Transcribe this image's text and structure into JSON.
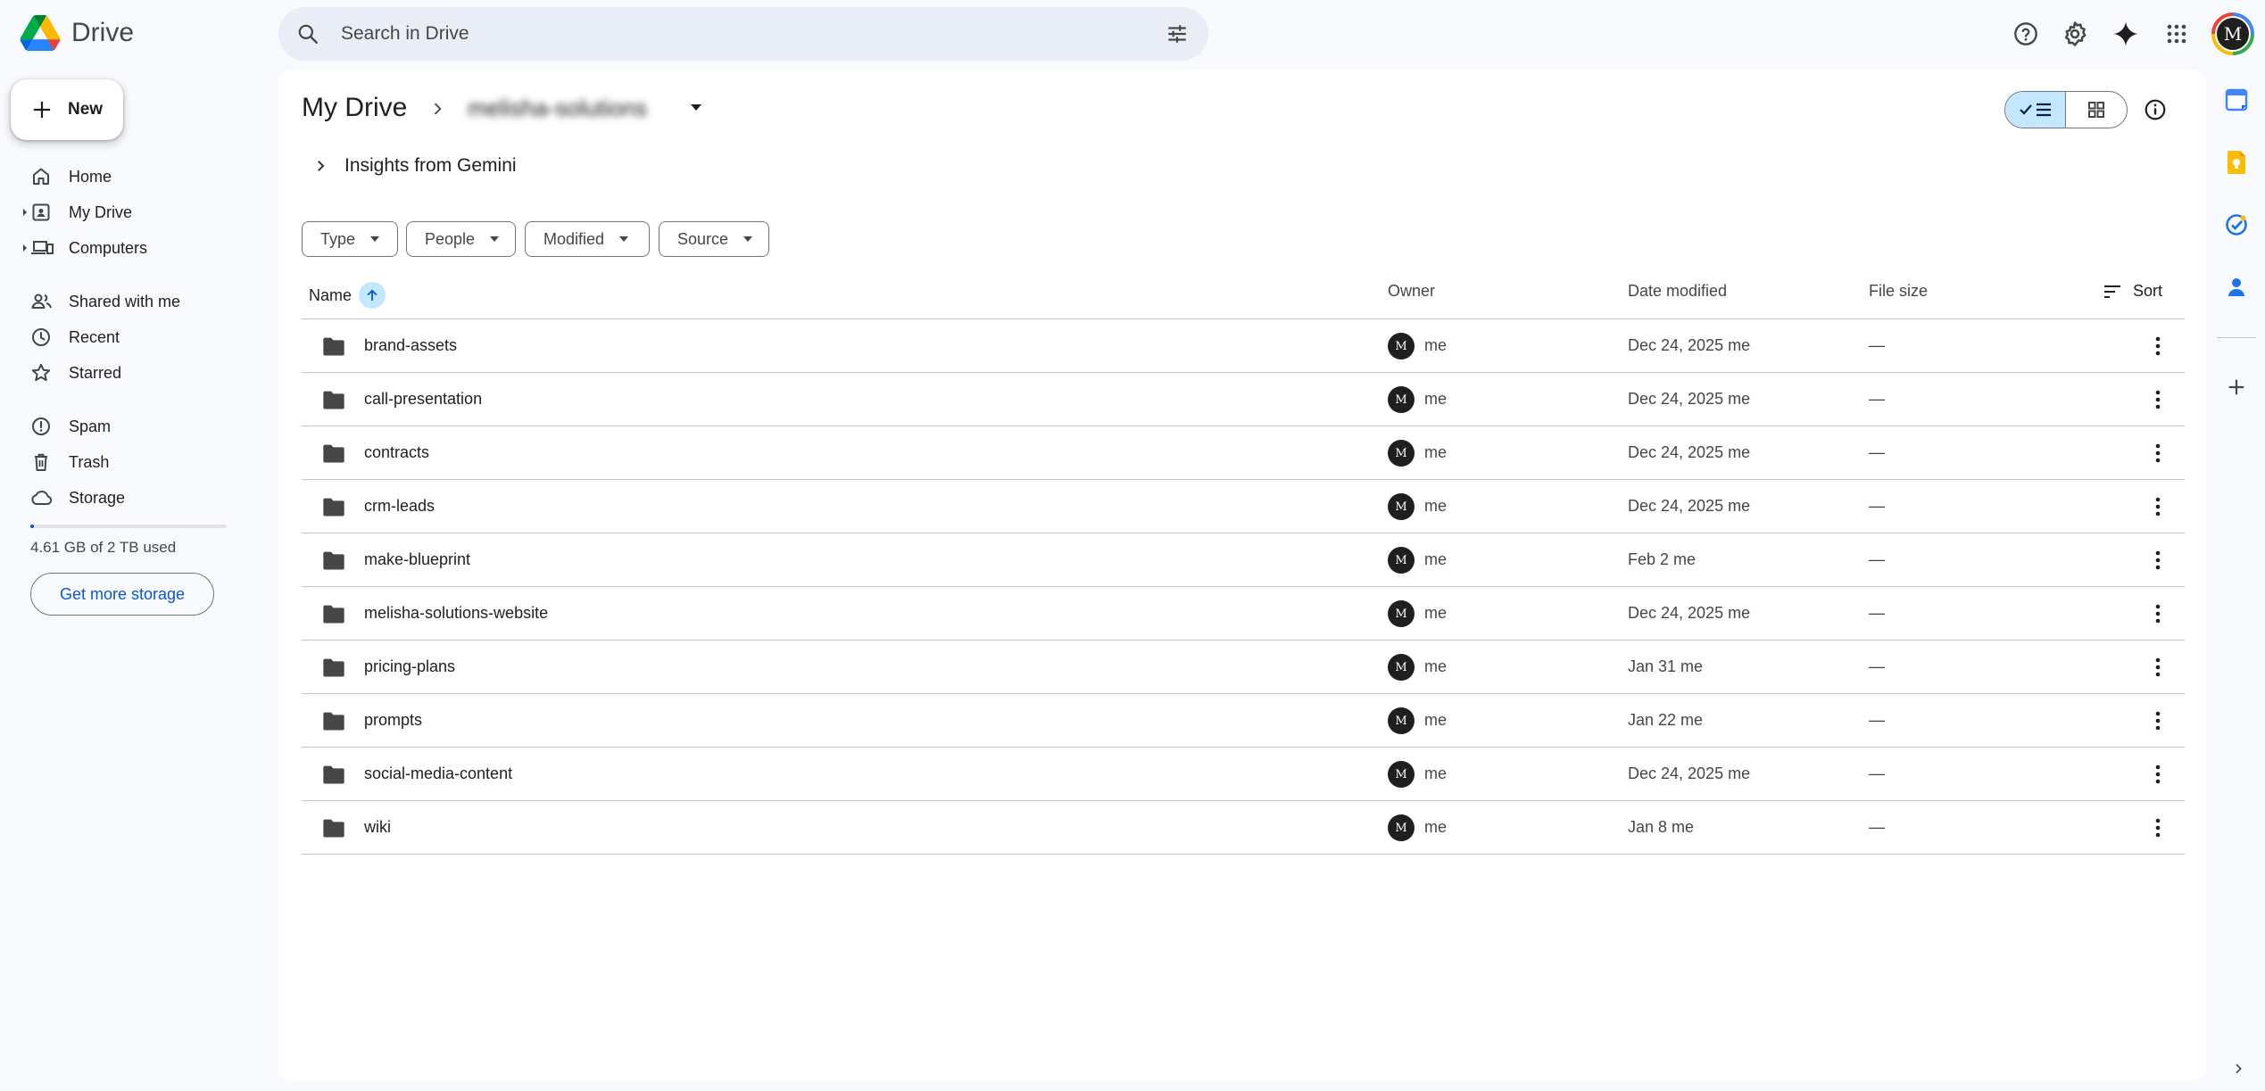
{
  "app": {
    "name": "Drive"
  },
  "search": {
    "placeholder": "Search in Drive"
  },
  "nav": {
    "new_label": "New",
    "items": [
      {
        "label": "Home",
        "icon": "home-icon"
      },
      {
        "label": "My Drive",
        "icon": "my-drive-icon"
      },
      {
        "label": "Computers",
        "icon": "computers-icon"
      },
      {
        "label": "Shared with me",
        "icon": "shared-icon"
      },
      {
        "label": "Recent",
        "icon": "clock-icon"
      },
      {
        "label": "Starred",
        "icon": "star-icon"
      },
      {
        "label": "Spam",
        "icon": "spam-icon"
      },
      {
        "label": "Trash",
        "icon": "trash-icon"
      },
      {
        "label": "Storage",
        "icon": "cloud-icon"
      }
    ],
    "storage_text": "4.61 GB of 2 TB used",
    "storage_fraction": 0.0023,
    "get_storage_label": "Get more storage"
  },
  "header": {
    "title": "My Drive",
    "breadcrumb_folder": "melisha-solutions",
    "insights_label": "Insights from Gemini"
  },
  "filters": [
    "Type",
    "People",
    "Modified",
    "Source"
  ],
  "table": {
    "columns": {
      "name": "Name",
      "owner": "Owner",
      "date_modified": "Date modified",
      "file_size": "File size",
      "sort": "Sort"
    },
    "rows": [
      {
        "name": "brand-assets",
        "owner": "me",
        "modified": "Dec 24, 2025 me",
        "size": "—"
      },
      {
        "name": "call-presentation",
        "owner": "me",
        "modified": "Dec 24, 2025 me",
        "size": "—"
      },
      {
        "name": "contracts",
        "owner": "me",
        "modified": "Dec 24, 2025 me",
        "size": "—"
      },
      {
        "name": "crm-leads",
        "owner": "me",
        "modified": "Dec 24, 2025 me",
        "size": "—"
      },
      {
        "name": "make-blueprint",
        "owner": "me",
        "modified": "Feb 2 me",
        "size": "—"
      },
      {
        "name": "melisha-solutions-website",
        "owner": "me",
        "modified": "Dec 24, 2025 me",
        "size": "—"
      },
      {
        "name": "pricing-plans",
        "owner": "me",
        "modified": "Jan 31 me",
        "size": "—"
      },
      {
        "name": "prompts",
        "owner": "me",
        "modified": "Jan 22 me",
        "size": "—"
      },
      {
        "name": "social-media-content",
        "owner": "me",
        "modified": "Dec 24, 2025 me",
        "size": "—"
      },
      {
        "name": "wiki",
        "owner": "me",
        "modified": "Jan 8 me",
        "size": "—"
      }
    ]
  },
  "avatar_initials": "M",
  "colors": {
    "accent": "#0b57d0",
    "selected": "#c2e7ff",
    "background": "#f8fafd"
  }
}
